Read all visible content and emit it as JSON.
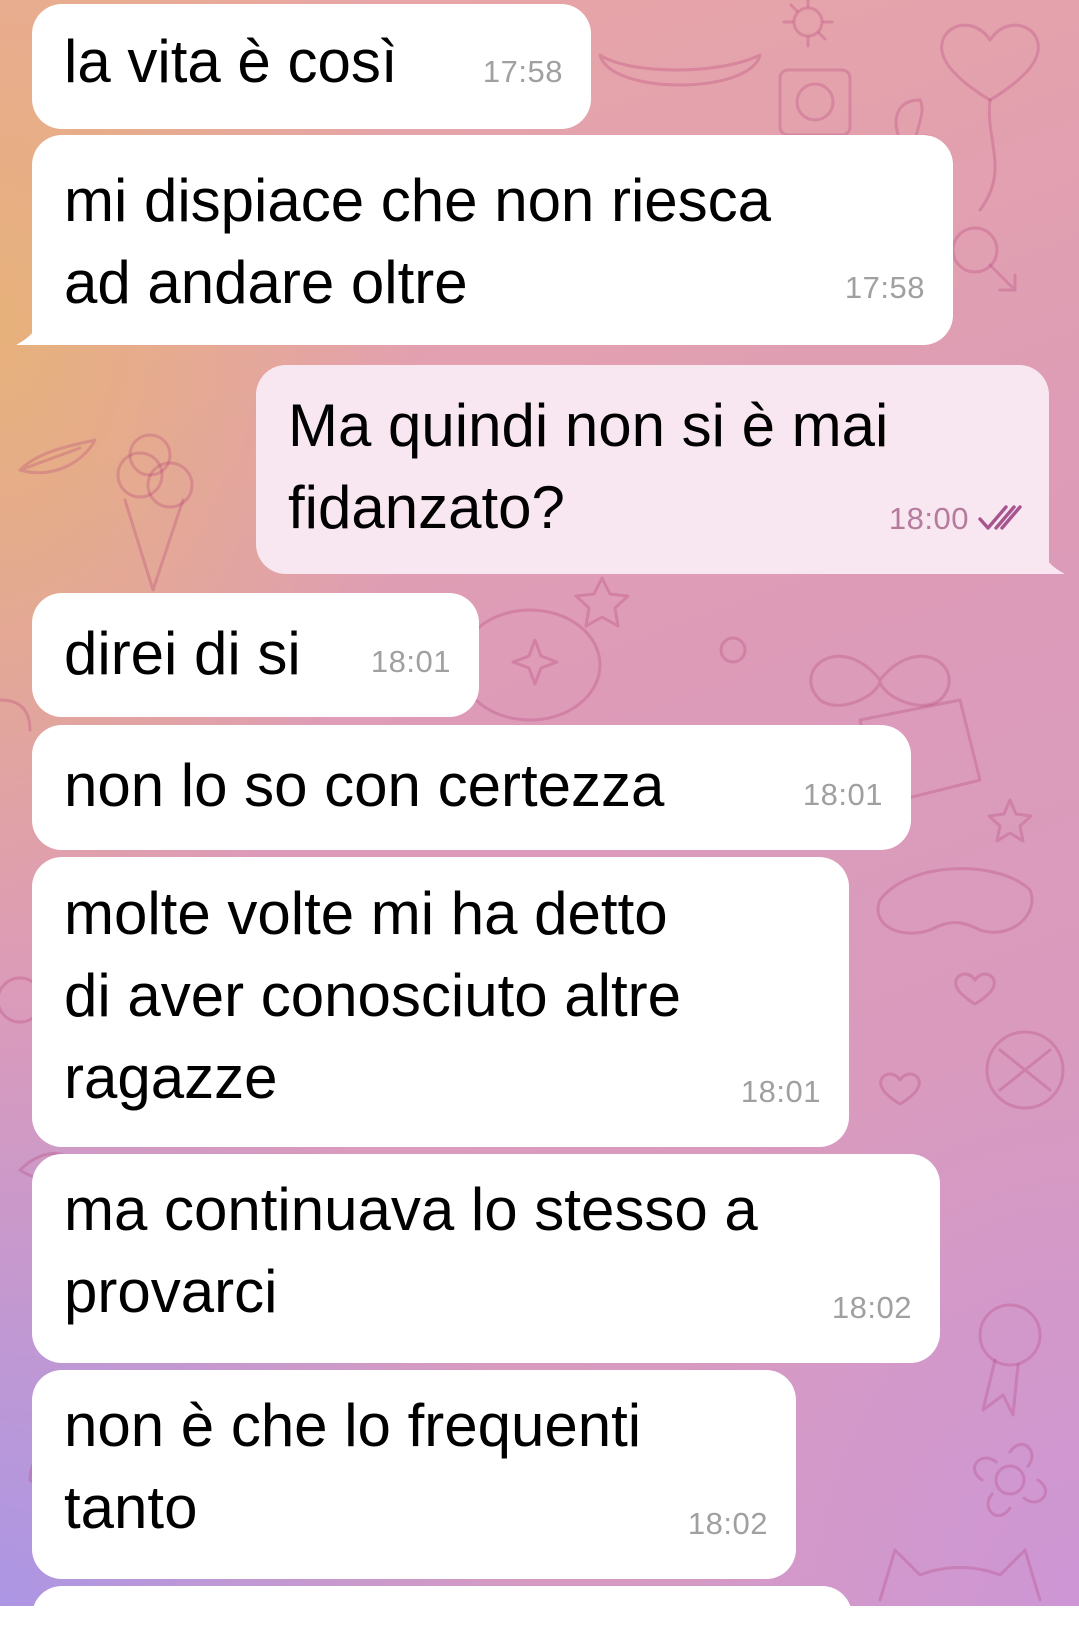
{
  "messages": [
    {
      "direction": "incoming",
      "text": "la vita è così",
      "time": "17:58"
    },
    {
      "direction": "incoming",
      "text": "mi dispiace che non riesca\nad andare oltre",
      "time": "17:58"
    },
    {
      "direction": "outgoing",
      "text": "Ma quindi non si è mai\nfidanzato?",
      "time": "18:00",
      "status": "read-double-check"
    },
    {
      "direction": "incoming",
      "text": "direi di si",
      "time": "18:01"
    },
    {
      "direction": "incoming",
      "text": "non lo so con certezza",
      "time": "18:01"
    },
    {
      "direction": "incoming",
      "text": "molte volte mi ha detto\ndi aver conosciuto altre\nragazze",
      "time": "18:01"
    },
    {
      "direction": "incoming",
      "text": "ma continuava lo stesso a\nprovarci",
      "time": "18:02"
    },
    {
      "direction": "incoming",
      "text": "non è che lo frequenti\ntanto",
      "time": "18:02"
    }
  ],
  "colors": {
    "incoming_bubble": "#ffffff",
    "outgoing_bubble": "#f8e7f0",
    "read_check": "#a7558f",
    "timestamp": "#a0a0a0"
  },
  "icons": {
    "read_status": "double-check-icon"
  }
}
